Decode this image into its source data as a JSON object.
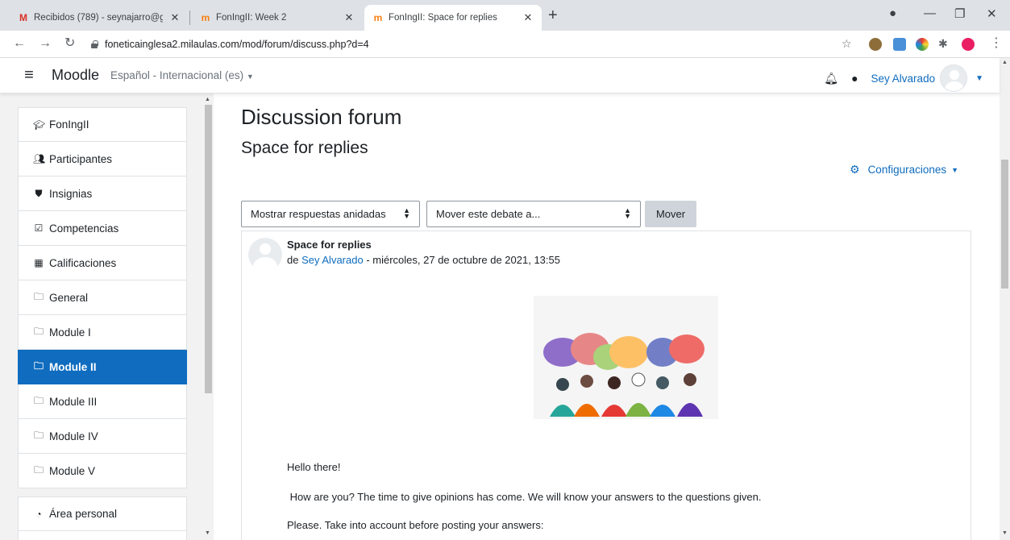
{
  "browser": {
    "tabs": [
      {
        "title": "Recibidos (789) - seynajarro@gm",
        "favicon": "gmail-m-icon",
        "active": false
      },
      {
        "title": "FonIngII: Week 2",
        "favicon": "moodle-m-icon",
        "active": false
      },
      {
        "title": "FonIngII: Space for replies",
        "favicon": "moodle-m-icon",
        "active": true
      }
    ],
    "url": "foneticainglesa2.milaulas.com/mod/forum/discuss.php?d=4"
  },
  "navbar": {
    "brand": "Moodle",
    "language": "Español - Internacional (es)",
    "user_name": "Sey Alvarado"
  },
  "drawer": {
    "items": [
      {
        "label": "FonIngII",
        "icon": "graduation-cap-icon"
      },
      {
        "label": "Participantes",
        "icon": "users-icon"
      },
      {
        "label": "Insignias",
        "icon": "shield-icon"
      },
      {
        "label": "Competencias",
        "icon": "check-square-icon"
      },
      {
        "label": "Calificaciones",
        "icon": "table-icon"
      },
      {
        "label": "General",
        "icon": "folder-icon"
      },
      {
        "label": "Module I",
        "icon": "folder-icon"
      },
      {
        "label": "Module II",
        "icon": "folder-icon",
        "active": true
      },
      {
        "label": "Module III",
        "icon": "folder-icon"
      },
      {
        "label": "Module IV",
        "icon": "folder-icon"
      },
      {
        "label": "Module V",
        "icon": "folder-icon"
      }
    ],
    "items2": [
      {
        "label": "Área personal",
        "icon": "tachometer-icon"
      }
    ]
  },
  "main": {
    "heading": "Discussion forum",
    "subheading": "Space for replies",
    "settings_label": "Configuraciones",
    "display_mode": "Mostrar respuestas anidadas",
    "move_select": "Mover este debate a...",
    "move_button": "Mover"
  },
  "post": {
    "title": "Space for replies",
    "by": "de",
    "author": "Sey Alvarado",
    "date": "- miércoles, 27 de octubre de 2021, 13:55",
    "paragraphs": [
      "Hello there!",
      " How are you? The time to give opinions has come. We will know your answers to the questions given.",
      "Please. Take into account before posting your answers:"
    ]
  },
  "colors": {
    "accent": "#0f6cbf",
    "drawer_bg": "#f2f2f2"
  }
}
